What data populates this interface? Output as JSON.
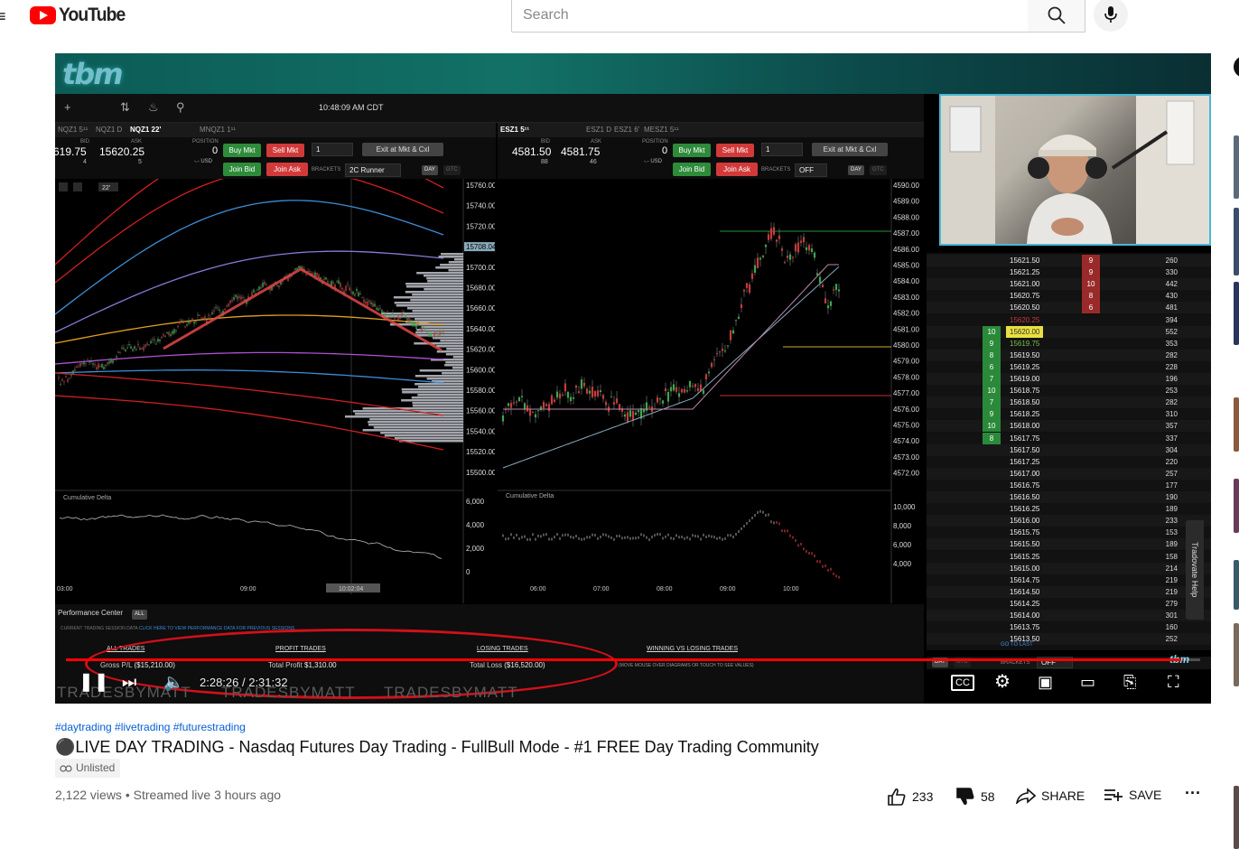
{
  "header": {
    "logo_text": "YouTube",
    "search_placeholder": "Search"
  },
  "trading": {
    "clock": "10:48:09 AM CDT",
    "left": {
      "tabs": [
        "NQZ1 5¹¹",
        "NQZ1 D",
        "NQZ1 22'",
        "MNQZ1 1¹¹"
      ],
      "bid": "619.75",
      "bid_size": "4",
      "ask": "15620.25",
      "ask_size": "5",
      "position": "0",
      "position_unit": "-.- USD",
      "buy_mkt": "Buy Mkt",
      "sell_mkt": "Sell Mkt",
      "join_bid": "Join Bid",
      "join_ask": "Join Ask",
      "qty": "1",
      "exit": "Exit at Mkt & Cxl",
      "brackets_label": "BRACKETS",
      "bracket": "2C Runner",
      "day": "DAY",
      "gtc": "GTC",
      "timeframe": "22'",
      "price_labels": [
        "15760.00",
        "15740.00",
        "15720.00",
        "15708.04",
        "15700.00",
        "15680.00",
        "15660.00",
        "15640.00",
        "15620.00",
        "15600.00",
        "15580.00",
        "15560.00",
        "15540.00",
        "15520.00",
        "15500.00"
      ],
      "delta_title": "Cumulative Delta",
      "delta_labels": [
        "6,000",
        "4,000",
        "2,000",
        "0"
      ],
      "time_labels": [
        "03:00",
        "09:00",
        "10:02:04"
      ]
    },
    "right": {
      "tabs": [
        "ESZ1 5¹¹",
        "ESZ1 D",
        "ESZ1 6'",
        "MESZ1 5¹¹"
      ],
      "bid": "4581.50",
      "bid_size": "88",
      "ask": "4581.75",
      "ask_size": "46",
      "position": "0",
      "position_unit": "-.- USD",
      "buy_mkt": "Buy Mkt",
      "sell_mkt": "Sell Mkt",
      "join_bid": "Join Bid",
      "join_ask": "Join Ask",
      "qty": "1",
      "exit": "Exit at Mkt & Cxl",
      "brackets_label": "BRACKETS",
      "bracket": "OFF",
      "day": "DAY",
      "gtc": "GTC",
      "price_labels": [
        "4590.00",
        "4589.00",
        "4588.00",
        "4587.00",
        "4586.00",
        "4585.00",
        "4584.00",
        "4583.00",
        "4582.00",
        "4581.00",
        "4580.00",
        "4579.00",
        "4578.00",
        "4577.00",
        "4576.00",
        "4575.00",
        "4574.00",
        "4573.00",
        "4572.00"
      ],
      "delta_title": "Cumulative Delta",
      "delta_labels": [
        "10,000",
        "8,000",
        "6,000",
        "4,000"
      ],
      "time_labels": [
        "06:00",
        "07:00",
        "08:00",
        "09:00",
        "10:00"
      ]
    },
    "perf": {
      "title": "Performance Center",
      "all_pill": "ALL",
      "note_prefix": "CURRENT TRADING SESSION DATA",
      "note_link": "CLICK HERE TO VIEW PERFORMANCE DATA FOR PREVIOUS SESSIONS",
      "all_trades": "ALL TRADES",
      "profit_trades": "PROFIT TRADES",
      "losing_trades": "LOSING TRADES",
      "winning_vs_losing": "WINNING VS LOSING TRADES",
      "gross_label": "Gross P/L",
      "gross_value": "($15,210.00)",
      "profit_label": "Total Profit",
      "profit_value": "$1,310.00",
      "loss_label": "Total Loss",
      "loss_value": "($16,520.00)",
      "hint": "(MOVE MOUSE OVER DIAGRAMS OR TOUCH TO SEE VALUES)"
    },
    "ladder": {
      "rows": [
        {
          "price": "15621.50",
          "bid": "",
          "ask": "9",
          "vol": "260"
        },
        {
          "price": "15621.25",
          "bid": "",
          "ask": "9",
          "vol": "330"
        },
        {
          "price": "15621.00",
          "bid": "",
          "ask": "10",
          "vol": "442"
        },
        {
          "price": "15620.75",
          "bid": "",
          "ask": "8",
          "vol": "430"
        },
        {
          "price": "15620.50",
          "bid": "",
          "ask": "6",
          "vol": "481"
        },
        {
          "price": "15620.25",
          "bid": "",
          "ask": "",
          "vol": "394"
        },
        {
          "price": "15620.00",
          "bid": "10",
          "ask": "",
          "vol": "552"
        },
        {
          "price": "15619.75",
          "bid": "9",
          "ask": "",
          "vol": "353"
        },
        {
          "price": "15619.50",
          "bid": "8",
          "ask": "",
          "vol": "282"
        },
        {
          "price": "15619.25",
          "bid": "6",
          "ask": "",
          "vol": "228"
        },
        {
          "price": "15619.00",
          "bid": "7",
          "ask": "",
          "vol": "196"
        },
        {
          "price": "15618.75",
          "bid": "10",
          "ask": "",
          "vol": "253"
        },
        {
          "price": "15618.50",
          "bid": "7",
          "ask": "",
          "vol": "282"
        },
        {
          "price": "15618.25",
          "bid": "9",
          "ask": "",
          "vol": "310"
        },
        {
          "price": "15618.00",
          "bid": "10",
          "ask": "",
          "vol": "357"
        },
        {
          "price": "15617.75",
          "bid": "8",
          "ask": "",
          "vol": "337"
        },
        {
          "price": "15617.50",
          "bid": "",
          "ask": "",
          "vol": "304"
        },
        {
          "price": "15617.25",
          "bid": "",
          "ask": "",
          "vol": "220"
        },
        {
          "price": "15617.00",
          "bid": "",
          "ask": "",
          "vol": "257"
        },
        {
          "price": "15616.75",
          "bid": "",
          "ask": "",
          "vol": "177"
        },
        {
          "price": "15616.50",
          "bid": "",
          "ask": "",
          "vol": "190"
        },
        {
          "price": "15616.25",
          "bid": "",
          "ask": "",
          "vol": "189"
        },
        {
          "price": "15616.00",
          "bid": "",
          "ask": "",
          "vol": "233"
        },
        {
          "price": "15615.75",
          "bid": "",
          "ask": "",
          "vol": "153"
        },
        {
          "price": "15615.50",
          "bid": "",
          "ask": "",
          "vol": "189"
        },
        {
          "price": "15615.25",
          "bid": "",
          "ask": "",
          "vol": "158"
        },
        {
          "price": "15615.00",
          "bid": "",
          "ask": "",
          "vol": "214"
        },
        {
          "price": "15614.75",
          "bid": "",
          "ask": "",
          "vol": "219"
        },
        {
          "price": "15614.50",
          "bid": "",
          "ask": "",
          "vol": "219"
        },
        {
          "price": "15614.25",
          "bid": "",
          "ask": "",
          "vol": "279"
        },
        {
          "price": "15614.00",
          "bid": "",
          "ask": "",
          "vol": "301"
        },
        {
          "price": "15613.75",
          "bid": "",
          "ask": "",
          "vol": "160"
        },
        {
          "price": "15613.50",
          "bid": "",
          "ask": "",
          "vol": "252"
        }
      ],
      "goto_last": "GO TO LAST",
      "brackets_label": "BRACKETS",
      "bracket": "OFF",
      "day": "DAY",
      "gtc": "GTC",
      "help_tab": "Tradovate Help"
    },
    "watermark": "TRADESBYMATT",
    "brand_small": "tbm"
  },
  "player": {
    "time": "2:28:26 / 2:31:32",
    "progress_fraction": 0.983
  },
  "video": {
    "hashtags": "#daytrading #livetrading #futurestrading",
    "title": "⚫LIVE DAY TRADING - Nasdaq Futures Day Trading - FullBull Mode - #1 FREE Day Trading Community",
    "unlisted": "Unlisted",
    "meta": "2,122 views • Streamed live 3 hours ago",
    "likes": "233",
    "dislikes": "58",
    "share": "SHARE",
    "save": "SAVE"
  }
}
